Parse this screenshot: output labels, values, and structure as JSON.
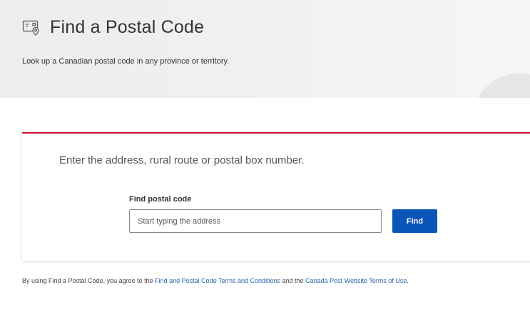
{
  "header": {
    "icon": "postal-map-icon",
    "title": "Find a Postal Code",
    "subtitle": "Look up a Canadian postal code in any province or territory."
  },
  "search": {
    "instruction": "Enter the address, rural route or postal box number.",
    "label": "Find postal code",
    "placeholder": "Start typing the address",
    "value": "",
    "button_label": "Find"
  },
  "terms": {
    "prefix": "By using Find a Postal Code, you agree to the",
    "link1": "Find and Postal Code Terms and Conditions",
    "middle": "and the",
    "link2": "Canada Post Website Terms of Use",
    "suffix": "."
  },
  "colors": {
    "accent_red": "#c8102e",
    "button_blue": "#0a55b8",
    "link_blue": "#2a62b0"
  }
}
